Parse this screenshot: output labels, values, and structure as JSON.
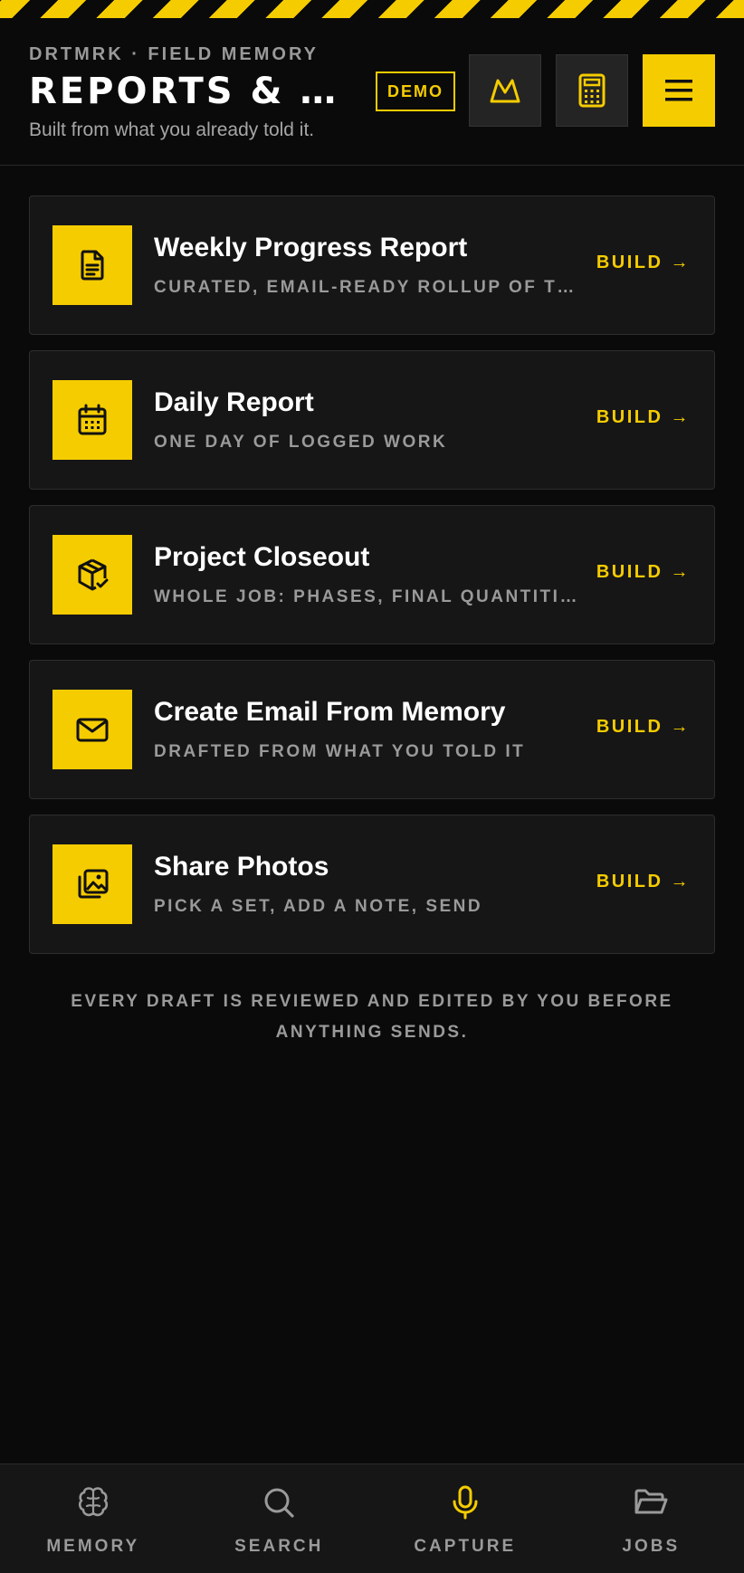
{
  "header": {
    "eyebrow": "DRTMRK · FIELD MEMORY",
    "title": "REPORTS & E...",
    "subtitle": "Built from what you already told it.",
    "demo_badge": "DEMO",
    "buttons": [
      {
        "icon": "crown-icon"
      },
      {
        "icon": "calculator-icon"
      },
      {
        "icon": "menu-icon"
      }
    ]
  },
  "cards": [
    {
      "icon": "document-icon",
      "title": "Weekly Progress Report",
      "subtitle": "CURATED, EMAIL-READY ROLLUP OF THE ...",
      "action": "BUILD →"
    },
    {
      "icon": "calendar-icon",
      "title": "Daily Report",
      "subtitle": "ONE DAY OF LOGGED WORK",
      "action": "BUILD →"
    },
    {
      "icon": "package-check-icon",
      "title": "Project Closeout",
      "subtitle": "WHOLE JOB: PHASES, FINAL QUANTITIES,...",
      "action": "BUILD →"
    },
    {
      "icon": "mail-icon",
      "title": "Create Email From Memory",
      "subtitle": "DRAFTED FROM WHAT YOU TOLD IT",
      "action": "BUILD →"
    },
    {
      "icon": "photos-icon",
      "title": "Share Photos",
      "subtitle": "PICK A SET, ADD A NOTE, SEND",
      "action": "BUILD →"
    }
  ],
  "footnote": "EVERY DRAFT IS REVIEWED AND EDITED BY YOU BEFORE ANYTHING SENDS.",
  "bottom_nav": [
    {
      "icon": "brain-icon",
      "label": "MEMORY"
    },
    {
      "icon": "search-icon",
      "label": "SEARCH"
    },
    {
      "icon": "microphone-icon",
      "label": "CAPTURE",
      "active": true
    },
    {
      "icon": "folder-icon",
      "label": "JOBS"
    }
  ],
  "colors": {
    "accent": "#f5cc00",
    "background": "#0a0a0a",
    "card": "#161616",
    "muted_text": "#9a9a9a"
  }
}
